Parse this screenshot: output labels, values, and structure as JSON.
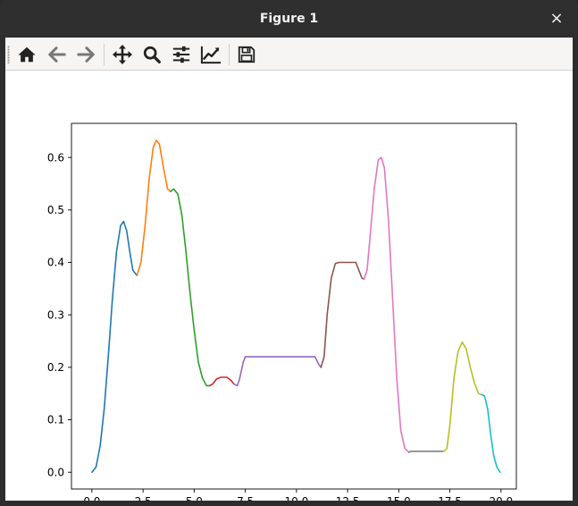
{
  "window": {
    "title": "Figure 1",
    "close_glyph": "×"
  },
  "toolbar": {
    "buttons": [
      {
        "icon": "home-icon"
      },
      {
        "icon": "back-arrow-icon"
      },
      {
        "icon": "forward-arrow-icon"
      },
      {
        "icon": "pan-icon"
      },
      {
        "icon": "zoom-icon"
      },
      {
        "icon": "configure-subplots-icon"
      },
      {
        "icon": "edit-axis-icon"
      },
      {
        "icon": "save-icon"
      }
    ]
  },
  "chart_data": {
    "type": "line",
    "title": "",
    "xlabel": "",
    "ylabel": "",
    "xlim": [
      -1.0,
      20.75
    ],
    "ylim": [
      -0.032,
      0.665
    ],
    "xticks": [
      0.0,
      2.5,
      5.0,
      7.5,
      10.0,
      12.5,
      15.0,
      17.5,
      20.0
    ],
    "xtick_labels": [
      "0.0",
      "2.5",
      "5.0",
      "7.5",
      "10.0",
      "12.5",
      "15.0",
      "17.5",
      "20.0"
    ],
    "yticks": [
      0.0,
      0.1,
      0.2,
      0.3,
      0.4,
      0.5,
      0.6
    ],
    "ytick_labels": [
      "0.0",
      "0.1",
      "0.2",
      "0.3",
      "0.4",
      "0.5",
      "0.6"
    ],
    "grid": false,
    "legend": false,
    "series": [
      {
        "color": "#1f77b4",
        "points": [
          [
            0.0,
            0.0
          ],
          [
            0.2,
            0.01
          ],
          [
            0.4,
            0.05
          ],
          [
            0.6,
            0.12
          ],
          [
            0.8,
            0.22
          ],
          [
            1.0,
            0.33
          ],
          [
            1.2,
            0.42
          ],
          [
            1.4,
            0.47
          ],
          [
            1.55,
            0.478
          ],
          [
            1.7,
            0.46
          ],
          [
            1.85,
            0.42
          ],
          [
            2.0,
            0.385
          ],
          [
            2.2,
            0.375
          ]
        ]
      },
      {
        "color": "#ff7f0e",
        "points": [
          [
            2.2,
            0.375
          ],
          [
            2.4,
            0.4
          ],
          [
            2.6,
            0.47
          ],
          [
            2.8,
            0.56
          ],
          [
            3.0,
            0.62
          ],
          [
            3.15,
            0.633
          ],
          [
            3.3,
            0.625
          ],
          [
            3.5,
            0.58
          ],
          [
            3.7,
            0.54
          ],
          [
            3.85,
            0.535
          ]
        ]
      },
      {
        "color": "#2ca02c",
        "points": [
          [
            3.85,
            0.535
          ],
          [
            4.0,
            0.54
          ],
          [
            4.2,
            0.53
          ],
          [
            4.4,
            0.49
          ],
          [
            4.6,
            0.42
          ],
          [
            4.8,
            0.34
          ],
          [
            5.0,
            0.27
          ],
          [
            5.2,
            0.21
          ],
          [
            5.4,
            0.18
          ],
          [
            5.6,
            0.165
          ],
          [
            5.75,
            0.165
          ]
        ]
      },
      {
        "color": "#d62728",
        "points": [
          [
            5.75,
            0.165
          ],
          [
            5.9,
            0.168
          ],
          [
            6.1,
            0.178
          ],
          [
            6.3,
            0.181
          ],
          [
            6.6,
            0.181
          ],
          [
            6.8,
            0.175
          ],
          [
            6.95,
            0.168
          ]
        ]
      },
      {
        "color": "#9467bd",
        "points": [
          [
            6.95,
            0.168
          ],
          [
            7.1,
            0.165
          ],
          [
            7.2,
            0.175
          ],
          [
            7.4,
            0.21
          ],
          [
            7.5,
            0.22
          ],
          [
            8.5,
            0.22
          ],
          [
            10.0,
            0.22
          ],
          [
            10.9,
            0.22
          ],
          [
            11.1,
            0.205
          ],
          [
            11.2,
            0.2
          ]
        ]
      },
      {
        "color": "#8c564b",
        "points": [
          [
            11.2,
            0.2
          ],
          [
            11.35,
            0.22
          ],
          [
            11.5,
            0.3
          ],
          [
            11.7,
            0.37
          ],
          [
            11.9,
            0.398
          ],
          [
            12.1,
            0.4
          ],
          [
            12.9,
            0.4
          ],
          [
            13.05,
            0.385
          ],
          [
            13.2,
            0.37
          ],
          [
            13.3,
            0.368
          ]
        ]
      },
      {
        "color": "#e377c2",
        "points": [
          [
            13.3,
            0.368
          ],
          [
            13.45,
            0.385
          ],
          [
            13.6,
            0.45
          ],
          [
            13.8,
            0.54
          ],
          [
            14.0,
            0.595
          ],
          [
            14.15,
            0.6
          ],
          [
            14.3,
            0.58
          ],
          [
            14.5,
            0.48
          ],
          [
            14.7,
            0.33
          ],
          [
            14.9,
            0.18
          ],
          [
            15.1,
            0.08
          ],
          [
            15.3,
            0.045
          ],
          [
            15.5,
            0.038
          ]
        ]
      },
      {
        "color": "#7f7f7f",
        "points": [
          [
            15.5,
            0.038
          ],
          [
            15.6,
            0.04
          ],
          [
            16.5,
            0.04
          ],
          [
            17.2,
            0.04
          ]
        ]
      },
      {
        "color": "#bcbd22",
        "points": [
          [
            17.2,
            0.04
          ],
          [
            17.35,
            0.045
          ],
          [
            17.5,
            0.09
          ],
          [
            17.7,
            0.18
          ],
          [
            17.9,
            0.23
          ],
          [
            18.1,
            0.248
          ],
          [
            18.3,
            0.235
          ],
          [
            18.5,
            0.2
          ],
          [
            18.7,
            0.17
          ],
          [
            18.9,
            0.15
          ],
          [
            19.05,
            0.148
          ]
        ]
      },
      {
        "color": "#17becf",
        "points": [
          [
            19.05,
            0.148
          ],
          [
            19.2,
            0.145
          ],
          [
            19.35,
            0.12
          ],
          [
            19.5,
            0.07
          ],
          [
            19.65,
            0.03
          ],
          [
            19.8,
            0.01
          ],
          [
            19.95,
            0.0
          ]
        ]
      }
    ]
  }
}
